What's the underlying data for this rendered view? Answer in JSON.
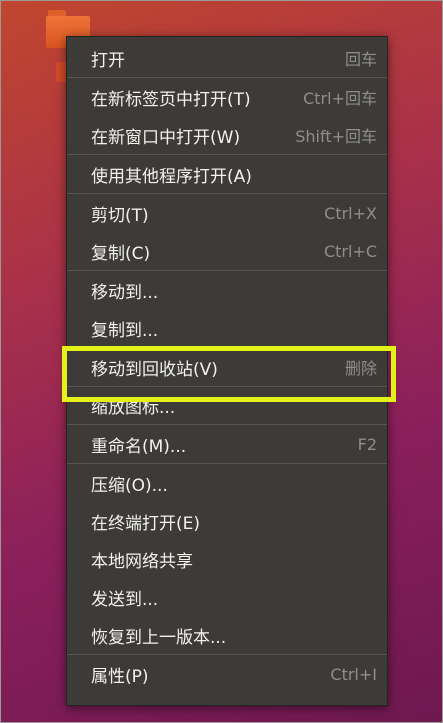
{
  "context_menu": {
    "groups": [
      [
        {
          "label": "打开",
          "shortcut": "回车"
        }
      ],
      [
        {
          "label": "在新标签页中打开(T)",
          "shortcut": "Ctrl+回车"
        },
        {
          "label": "在新窗口中打开(W)",
          "shortcut": "Shift+回车"
        }
      ],
      [
        {
          "label": "使用其他程序打开(A)",
          "shortcut": ""
        }
      ],
      [
        {
          "label": "剪切(T)",
          "shortcut": "Ctrl+X"
        },
        {
          "label": "复制(C)",
          "shortcut": "Ctrl+C"
        }
      ],
      [
        {
          "label": "移动到...",
          "shortcut": ""
        },
        {
          "label": "复制到...",
          "shortcut": ""
        }
      ],
      [
        {
          "label": "移动到回收站(V)",
          "shortcut": "删除"
        }
      ],
      [
        {
          "label": "缩放图标...",
          "shortcut": ""
        }
      ],
      [
        {
          "label": "重命名(M)...",
          "shortcut": "F2"
        }
      ],
      [
        {
          "label": "压缩(O)...",
          "shortcut": ""
        },
        {
          "label": "在终端打开(E)",
          "shortcut": ""
        },
        {
          "label": "本地网络共享",
          "shortcut": ""
        },
        {
          "label": "发送到...",
          "shortcut": ""
        },
        {
          "label": "恢复到上一版本...",
          "shortcut": ""
        }
      ],
      [
        {
          "label": "属性(P)",
          "shortcut": "Ctrl+I"
        }
      ]
    ]
  },
  "colors": {
    "menu_bg": "#3c3b37",
    "highlight_border": "#e4f117",
    "folder_orange": "#e0602c"
  },
  "icons": {
    "folder": "folder-icon"
  }
}
